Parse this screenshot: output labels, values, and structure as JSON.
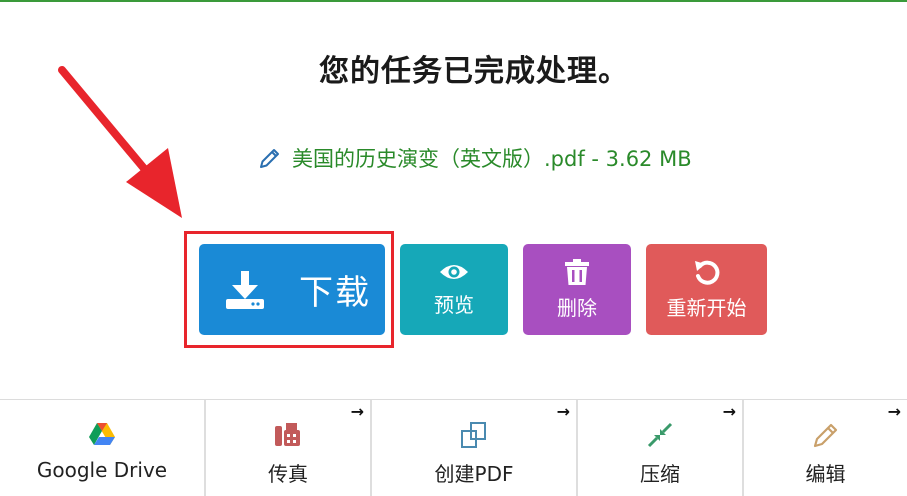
{
  "header": {
    "title": "您的任务已完成处理。"
  },
  "file": {
    "name": "美国的历史演变（英文版）.pdf - 3.62 MB"
  },
  "actions": {
    "download_label": "下载",
    "preview_label": "预览",
    "delete_label": "删除",
    "restart_label": "重新开始"
  },
  "tools": [
    {
      "label": "Google Drive",
      "icon": "google-drive-icon"
    },
    {
      "label": "传真",
      "icon": "fax-icon"
    },
    {
      "label": "创建PDF",
      "icon": "create-pdf-icon"
    },
    {
      "label": "压缩",
      "icon": "compress-icon"
    },
    {
      "label": "编辑",
      "icon": "edit-pencil-icon"
    }
  ],
  "colors": {
    "download": "#1a8ad6",
    "preview": "#16a8b8",
    "delete": "#a84fc0",
    "restart": "#e05a5a",
    "highlight": "#e8252c",
    "file_text": "#2a8a2a"
  }
}
